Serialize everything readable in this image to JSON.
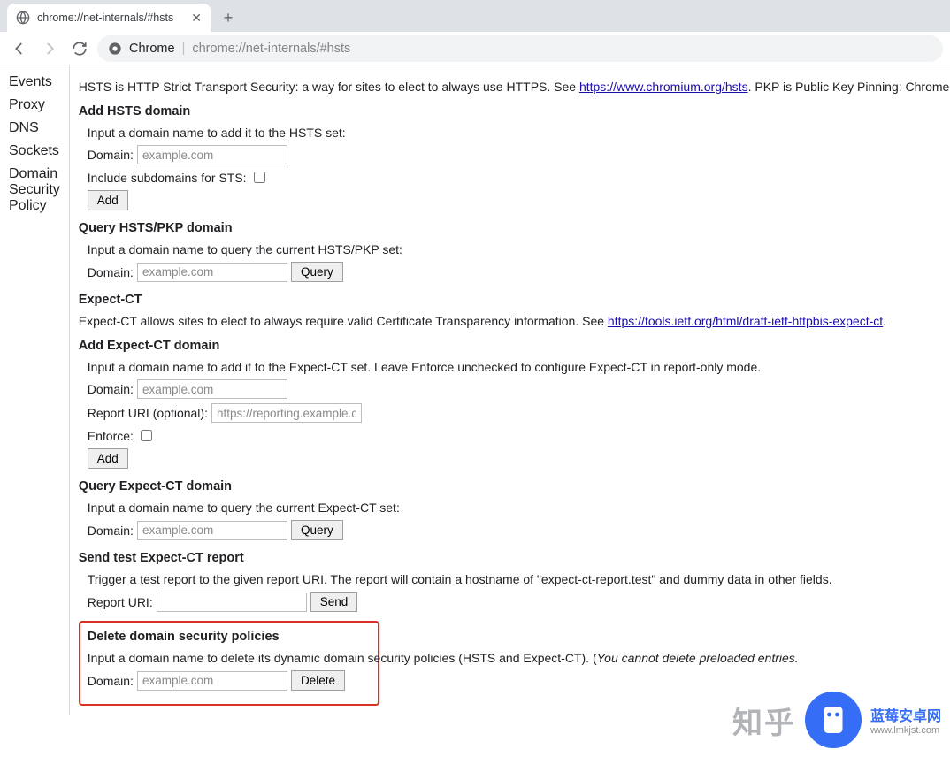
{
  "tab": {
    "title": "chrome://net-internals/#hsts"
  },
  "omnibox": {
    "origin_label": "Chrome",
    "url": "chrome://net-internals/#hsts"
  },
  "sidebar": {
    "items": [
      {
        "label": "Events"
      },
      {
        "label": "Proxy"
      },
      {
        "label": "DNS"
      },
      {
        "label": "Sockets"
      },
      {
        "label": "Domain Security Policy"
      }
    ]
  },
  "content": {
    "intro_prefix": "HSTS is HTTP Strict Transport Security: a way for sites to elect to always use HTTPS. See ",
    "intro_link": "https://www.chromium.org/hsts",
    "intro_suffix": ". PKP is Public Key Pinning: Chrome \"pins\" certai",
    "add_hsts": {
      "heading": "Add HSTS domain",
      "instruction": "Input a domain name to add it to the HSTS set:",
      "domain_label": "Domain:",
      "domain_placeholder": "example.com",
      "subdomain_label": "Include subdomains for STS:",
      "button": "Add"
    },
    "query_hsts": {
      "heading": "Query HSTS/PKP domain",
      "instruction": "Input a domain name to query the current HSTS/PKP set:",
      "domain_label": "Domain:",
      "domain_placeholder": "example.com",
      "button": "Query"
    },
    "expect_ct": {
      "heading": "Expect-CT",
      "intro_prefix": "Expect-CT allows sites to elect to always require valid Certificate Transparency information. See ",
      "intro_link": "https://tools.ietf.org/html/draft-ietf-httpbis-expect-ct",
      "intro_suffix": "."
    },
    "add_expect": {
      "heading": "Add Expect-CT domain",
      "instruction": "Input a domain name to add it to the Expect-CT set. Leave Enforce unchecked to configure Expect-CT in report-only mode.",
      "domain_label": "Domain:",
      "domain_placeholder": "example.com",
      "report_label": "Report URI (optional):",
      "report_placeholder": "https://reporting.example.com",
      "enforce_label": "Enforce:",
      "button": "Add"
    },
    "query_expect": {
      "heading": "Query Expect-CT domain",
      "instruction": "Input a domain name to query the current Expect-CT set:",
      "domain_label": "Domain:",
      "domain_placeholder": "example.com",
      "button": "Query"
    },
    "send_test": {
      "heading": "Send test Expect-CT report",
      "instruction": "Trigger a test report to the given report URI. The report will contain a hostname of \"expect-ct-report.test\" and dummy data in other fields.",
      "report_label": "Report URI:",
      "button": "Send"
    },
    "delete": {
      "heading": "Delete domain security policies",
      "instruction_prefix": "Input a domain name to delete its dynamic domain security policies (HSTS and Expect-CT). (",
      "instruction_italic": "You cannot delete preloaded entries.",
      "domain_label": "Domain:",
      "domain_placeholder": "example.com",
      "button": "Delete"
    }
  },
  "watermark": {
    "zhihu": "知乎",
    "brand": "蓝莓安卓网",
    "url": "www.lmkjst.com"
  }
}
